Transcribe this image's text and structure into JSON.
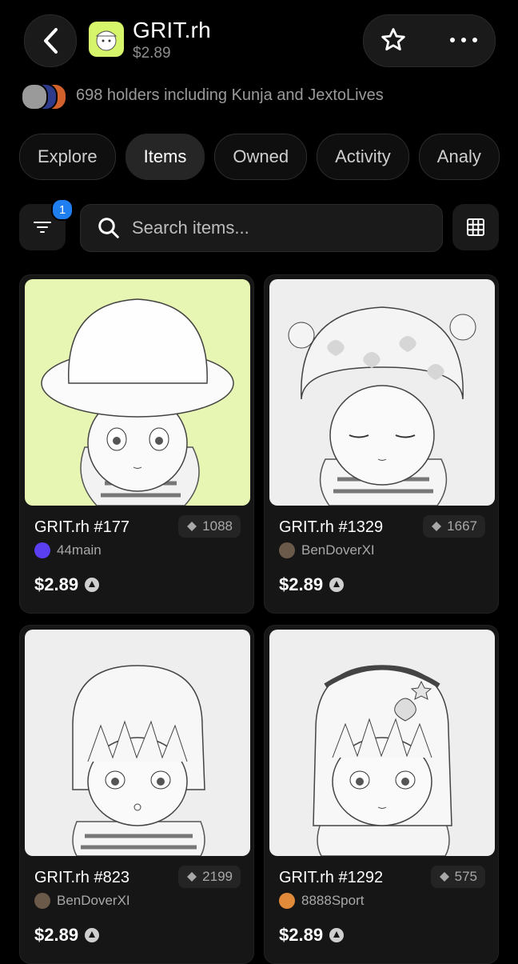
{
  "header": {
    "title": "GRIT.rh",
    "price": "$2.89",
    "holders_text": "698 holders including Kunja and JextoLives"
  },
  "tabs": [
    {
      "label": "Explore",
      "active": false
    },
    {
      "label": "Items",
      "active": true
    },
    {
      "label": "Owned",
      "active": false
    },
    {
      "label": "Activity",
      "active": false
    },
    {
      "label": "Analy",
      "active": false
    }
  ],
  "filter": {
    "badge": "1"
  },
  "search": {
    "placeholder": "Search items..."
  },
  "items": [
    {
      "name": "GRIT.rh #177",
      "rank": "1088",
      "owner": "44main",
      "price": "$2.89",
      "bg": "#e8f6b4",
      "owner_color": "#5a3ff0"
    },
    {
      "name": "GRIT.rh #1329",
      "rank": "1667",
      "owner": "BenDoverXI",
      "price": "$2.89",
      "bg": "#eeeeee",
      "owner_color": "#6b5a4a"
    },
    {
      "name": "GRIT.rh #823",
      "rank": "2199",
      "owner": "BenDoverXI",
      "price": "$2.89",
      "bg": "#eeeeee",
      "owner_color": "#6b5a4a"
    },
    {
      "name": "GRIT.rh #1292",
      "rank": "575",
      "owner": "8888Sport",
      "price": "$2.89",
      "bg": "#eeeeee",
      "owner_color": "#e08a3a"
    }
  ],
  "colors": {
    "accent_badge": "#1f7ef0",
    "logo_bg": "#d6f56b"
  }
}
